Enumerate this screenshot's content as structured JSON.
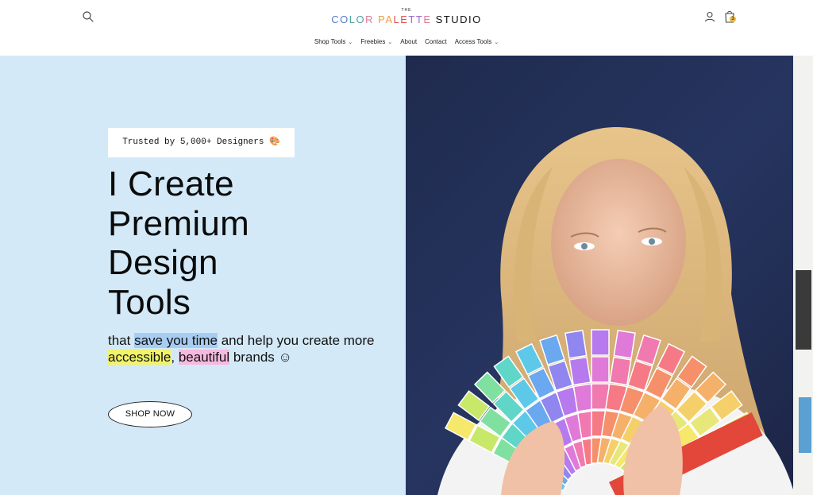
{
  "header": {
    "logo_the": "THE",
    "logo_letters": [
      {
        "ch": "C",
        "color": "#5a7ac8"
      },
      {
        "ch": "O",
        "color": "#5a7ac8"
      },
      {
        "ch": "L",
        "color": "#4fa3a0"
      },
      {
        "ch": "O",
        "color": "#4fa3a0"
      },
      {
        "ch": "R",
        "color": "#e07a9a"
      },
      {
        "ch": " ",
        "color": "#111111"
      },
      {
        "ch": "P",
        "color": "#e9a03b"
      },
      {
        "ch": "A",
        "color": "#e9a03b"
      },
      {
        "ch": "L",
        "color": "#d9534f"
      },
      {
        "ch": "E",
        "color": "#d9534f"
      },
      {
        "ch": "T",
        "color": "#9b6ad1"
      },
      {
        "ch": "T",
        "color": "#9b6ad1"
      },
      {
        "ch": "E",
        "color": "#e07a9a"
      },
      {
        "ch": " ",
        "color": "#111111"
      },
      {
        "ch": "S",
        "color": "#111111"
      },
      {
        "ch": "T",
        "color": "#111111"
      },
      {
        "ch": "U",
        "color": "#111111"
      },
      {
        "ch": "D",
        "color": "#111111"
      },
      {
        "ch": "I",
        "color": "#111111"
      },
      {
        "ch": "O",
        "color": "#111111"
      }
    ],
    "cart_count": "3"
  },
  "nav": {
    "items": [
      {
        "label": "Shop Tools",
        "chevron": true
      },
      {
        "label": "Freebies",
        "chevron": true
      },
      {
        "label": "About",
        "chevron": false
      },
      {
        "label": "Contact",
        "chevron": false
      },
      {
        "label": "Access Tools",
        "chevron": true
      }
    ]
  },
  "hero": {
    "badge": "Trusted by 5,000+ Designers 🎨",
    "headline_lines": [
      "I Create",
      "Premium",
      "Design",
      "Tools"
    ],
    "sub_1": "that ",
    "sub_hl_1": "save you time",
    "sub_2": " and help you create more ",
    "sub_hl_2": "accessible",
    "sub_3": ", ",
    "sub_hl_3": "beautiful",
    "sub_4": " brands ☺",
    "cta": "SHOP NOW"
  },
  "colors": {
    "hero_bg": "#d3e9f7",
    "highlight_blue": "#a8cdf2",
    "highlight_yellow": "#f1f36a",
    "highlight_pink": "#f6b9e0",
    "cart_badge": "#e8b84a"
  }
}
